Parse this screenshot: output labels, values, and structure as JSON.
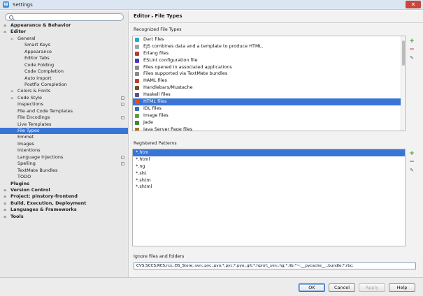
{
  "window": {
    "title": "Settings"
  },
  "search": {
    "placeholder": ""
  },
  "tree": [
    {
      "label": "Appearance & Behavior",
      "level": 0,
      "expand": "collapsed",
      "bold": true,
      "selected": false,
      "scope": false
    },
    {
      "label": "Editor",
      "level": 0,
      "expand": "expanded",
      "bold": true,
      "selected": false,
      "scope": false
    },
    {
      "label": "General",
      "level": 1,
      "expand": "expanded",
      "bold": false,
      "selected": false,
      "scope": false
    },
    {
      "label": "Smart Keys",
      "level": 2,
      "expand": "none",
      "bold": false,
      "selected": false,
      "scope": false
    },
    {
      "label": "Appearance",
      "level": 2,
      "expand": "none",
      "bold": false,
      "selected": false,
      "scope": false
    },
    {
      "label": "Editor Tabs",
      "level": 2,
      "expand": "none",
      "bold": false,
      "selected": false,
      "scope": false
    },
    {
      "label": "Code Folding",
      "level": 2,
      "expand": "none",
      "bold": false,
      "selected": false,
      "scope": false
    },
    {
      "label": "Code Completion",
      "level": 2,
      "expand": "none",
      "bold": false,
      "selected": false,
      "scope": false
    },
    {
      "label": "Auto Import",
      "level": 2,
      "expand": "none",
      "bold": false,
      "selected": false,
      "scope": false
    },
    {
      "label": "Postfix Completion",
      "level": 2,
      "expand": "none",
      "bold": false,
      "selected": false,
      "scope": false
    },
    {
      "label": "Colors & Fonts",
      "level": 1,
      "expand": "collapsed",
      "bold": false,
      "selected": false,
      "scope": false
    },
    {
      "label": "Code Style",
      "level": 1,
      "expand": "collapsed",
      "bold": false,
      "selected": false,
      "scope": true
    },
    {
      "label": "Inspections",
      "level": 1,
      "expand": "none",
      "bold": false,
      "selected": false,
      "scope": true
    },
    {
      "label": "File and Code Templates",
      "level": 1,
      "expand": "none",
      "bold": false,
      "selected": false,
      "scope": false
    },
    {
      "label": "File Encodings",
      "level": 1,
      "expand": "none",
      "bold": false,
      "selected": false,
      "scope": true
    },
    {
      "label": "Live Templates",
      "level": 1,
      "expand": "none",
      "bold": false,
      "selected": false,
      "scope": false
    },
    {
      "label": "File Types",
      "level": 1,
      "expand": "none",
      "bold": false,
      "selected": true,
      "scope": false
    },
    {
      "label": "Emmet",
      "level": 1,
      "expand": "none",
      "bold": false,
      "selected": false,
      "scope": false
    },
    {
      "label": "Images",
      "level": 1,
      "expand": "none",
      "bold": false,
      "selected": false,
      "scope": false
    },
    {
      "label": "Intentions",
      "level": 1,
      "expand": "none",
      "bold": false,
      "selected": false,
      "scope": false
    },
    {
      "label": "Language Injections",
      "level": 1,
      "expand": "none",
      "bold": false,
      "selected": false,
      "scope": true
    },
    {
      "label": "Spelling",
      "level": 1,
      "expand": "none",
      "bold": false,
      "selected": false,
      "scope": true
    },
    {
      "label": "TextMate Bundles",
      "level": 1,
      "expand": "none",
      "bold": false,
      "selected": false,
      "scope": false
    },
    {
      "label": "TODO",
      "level": 1,
      "expand": "none",
      "bold": false,
      "selected": false,
      "scope": false
    },
    {
      "label": "Plugins",
      "level": 0,
      "expand": "none",
      "bold": true,
      "selected": false,
      "scope": false
    },
    {
      "label": "Version Control",
      "level": 0,
      "expand": "collapsed",
      "bold": true,
      "selected": false,
      "scope": false
    },
    {
      "label": "Project: pinstory-frontend",
      "level": 0,
      "expand": "collapsed",
      "bold": true,
      "selected": false,
      "scope": false
    },
    {
      "label": "Build, Execution, Deployment",
      "level": 0,
      "expand": "collapsed",
      "bold": true,
      "selected": false,
      "scope": false
    },
    {
      "label": "Languages & Frameworks",
      "level": 0,
      "expand": "collapsed",
      "bold": true,
      "selected": false,
      "scope": false
    },
    {
      "label": "Tools",
      "level": 0,
      "expand": "collapsed",
      "bold": true,
      "selected": false,
      "scope": false
    }
  ],
  "breadcrumb": {
    "parent": "Editor",
    "separator": "▸",
    "current": "File Types"
  },
  "recognized": {
    "label": "Recognized File Types",
    "items": [
      {
        "label": "Dart files",
        "icon": "dart-icon",
        "color": "#2aa7c9",
        "selected": false
      },
      {
        "label": "EJS combines data and a template to produce HTML.",
        "icon": "ejs-icon",
        "color": "#9aa3ad",
        "selected": false
      },
      {
        "label": "Erlang files",
        "icon": "erlang-icon",
        "color": "#b0402f",
        "selected": false
      },
      {
        "label": "ESLint configuration file",
        "icon": "eslint-icon",
        "color": "#4b32c3",
        "selected": false
      },
      {
        "label": "Files opened in associated applications",
        "icon": "external-file-icon",
        "color": "#8a8a8a",
        "selected": false
      },
      {
        "label": "Files supported via TextMate bundles",
        "icon": "textmate-icon",
        "color": "#8a8a8a",
        "selected": false
      },
      {
        "label": "HAML files",
        "icon": "haml-icon",
        "color": "#c0392b",
        "selected": false
      },
      {
        "label": "Handlebars/Mustache",
        "icon": "handlebars-icon",
        "color": "#7a4a1a",
        "selected": false
      },
      {
        "label": "Haskell files",
        "icon": "haskell-icon",
        "color": "#5e5086",
        "selected": false
      },
      {
        "label": "HTML files",
        "icon": "html-icon",
        "color": "#e44d26",
        "selected": true
      },
      {
        "label": "IDL files",
        "icon": "idl-icon",
        "color": "#3b6fb6",
        "selected": false
      },
      {
        "label": "Image files",
        "icon": "image-icon",
        "color": "#6a9a3a",
        "selected": false
      },
      {
        "label": "Jade",
        "icon": "jade-icon",
        "color": "#3a8a3a",
        "selected": false
      },
      {
        "label": "Java Server Page files",
        "icon": "jsp-icon",
        "color": "#b07219",
        "selected": false
      }
    ]
  },
  "patterns": {
    "label": "Registered Patterns",
    "items": [
      {
        "label": "*.htm",
        "selected": true
      },
      {
        "label": "*.html",
        "selected": false
      },
      {
        "label": "*.ng",
        "selected": false
      },
      {
        "label": "*.sht",
        "selected": false
      },
      {
        "label": "*.shtm",
        "selected": false
      },
      {
        "label": "*.shtml",
        "selected": false
      }
    ]
  },
  "ignore": {
    "label": "Ignore files and folders",
    "value": "CVS;SCCS;RCS;rcs;.DS_Store;.svn;.pyc;.pyo;*.pyc;*.pyo;.git;*.hprof;_svn;.hg;*.lib;*~;__pycache__;.bundle;*.rbc;"
  },
  "tools": {
    "add": "+",
    "remove": "−",
    "edit": "✎"
  },
  "buttons": {
    "ok": "OK",
    "cancel": "Cancel",
    "apply": "Apply",
    "help": "Help"
  },
  "colors": {
    "selection": "#3875d7",
    "add": "#3a9a3a",
    "remove": "#c0392b"
  }
}
